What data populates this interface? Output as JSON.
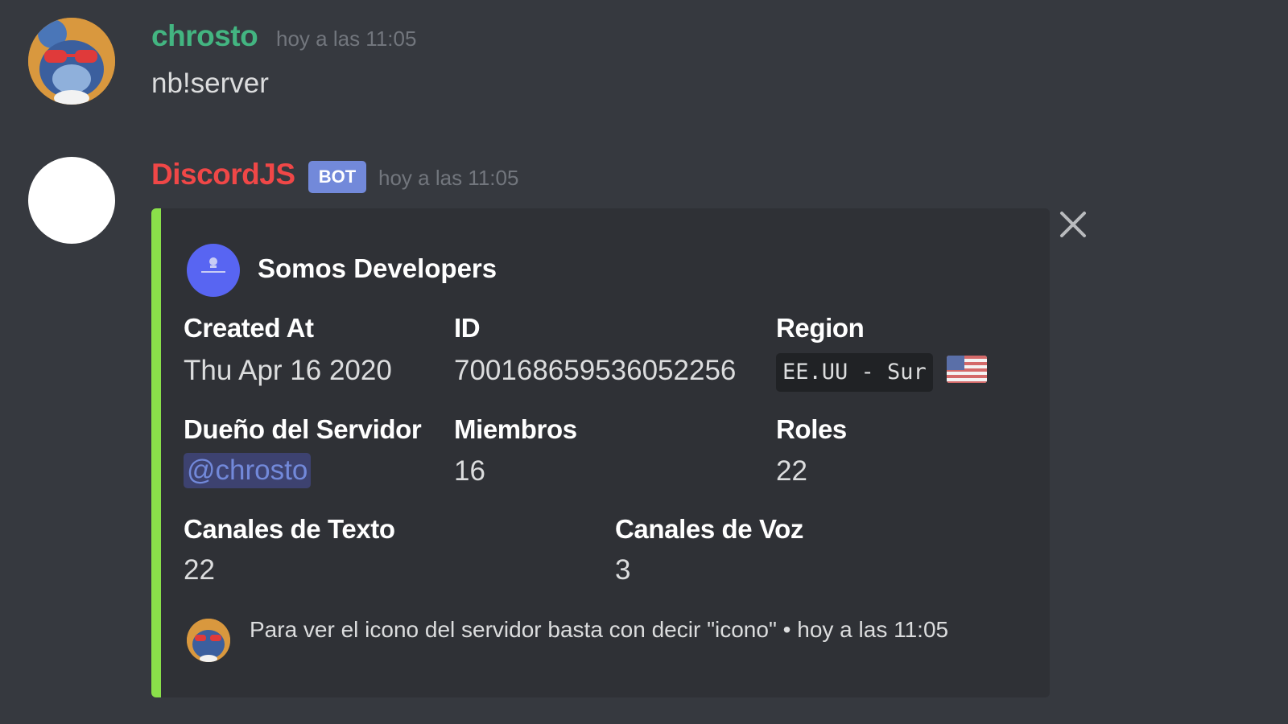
{
  "messages": [
    {
      "username": "chrosto",
      "username_color": "#43b581",
      "timestamp": "hoy a las 11:05",
      "content": "nb!server"
    },
    {
      "username": "DiscordJS",
      "username_color": "#f04747",
      "bot_tag": "BOT",
      "timestamp": "hoy a las 11:05",
      "embed": {
        "accent_color": "#8ae04a",
        "author": {
          "name": "Somos Developers",
          "icon": "server-icon"
        },
        "fields": {
          "created_at": {
            "name": "Created At",
            "value": "Thu Apr 16 2020"
          },
          "id": {
            "name": "ID",
            "value": "700168659536052256"
          },
          "region": {
            "name": "Region",
            "value": "EE.UU - Sur",
            "flag": "us-flag-icon"
          },
          "owner": {
            "name": "Dueño del Servidor",
            "value": "@chrosto"
          },
          "members": {
            "name": "Miembros",
            "value": "16"
          },
          "roles": {
            "name": "Roles",
            "value": "22"
          },
          "text_channels": {
            "name": "Canales de Texto",
            "value": "22"
          },
          "voice_channels": {
            "name": "Canales de Voz",
            "value": "3"
          }
        },
        "footer": {
          "text": "Para ver el icono del servidor basta con decir \"icono\" • hoy a las 11:05"
        }
      }
    }
  ],
  "close_icon": "close-icon"
}
